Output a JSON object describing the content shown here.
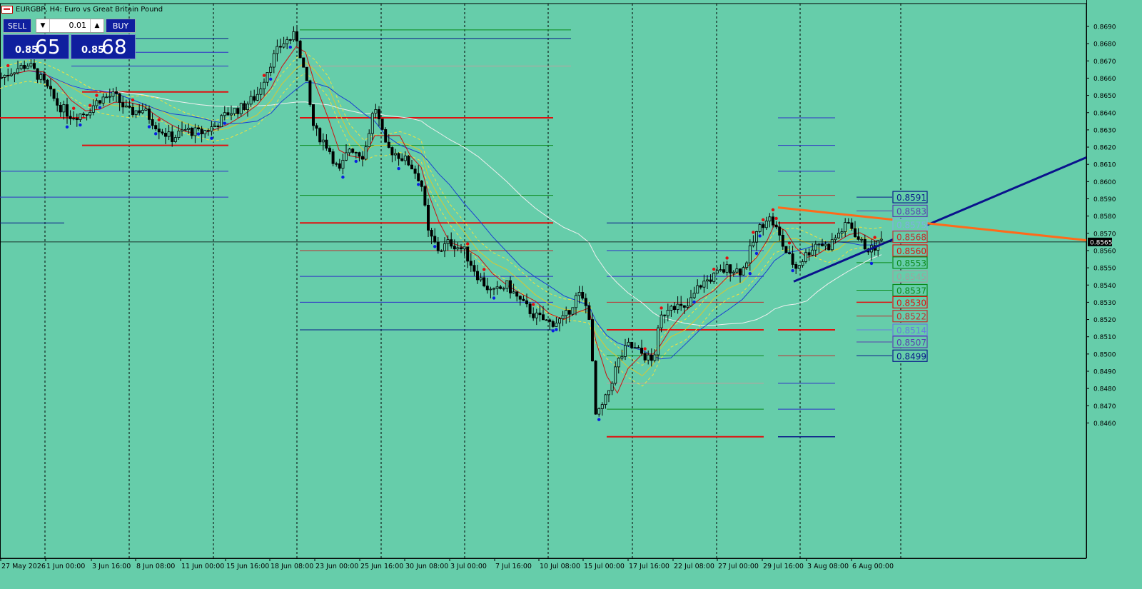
{
  "header": {
    "symbol_title": "EURGBP, H4: Euro vs Great Britain Pound"
  },
  "trade_panel": {
    "sell_label": "SELL",
    "buy_label": "BUY",
    "lot_value": "0.01",
    "sell_price_prefix": "0.85",
    "sell_price_big": "65",
    "buy_price_prefix": "0.85",
    "buy_price_big": "68"
  },
  "colors": {
    "background": "#66cdaa",
    "bull_candle": "#000000",
    "bear_candle": "#000000",
    "ma_red": "#cc1111",
    "ma_blue": "#1a3fd1",
    "ma_white": "#f0f0f0",
    "envelope_yellow": "#f0e040",
    "trendline_blue": "#0a128c",
    "trendline_orange": "#ff6a1a",
    "level_red": "#e01010",
    "level_green": "#0a8a1a",
    "level_blue": "#3030c8",
    "level_darkblue": "#0a1a8a"
  },
  "chart_data": {
    "type": "candlestick",
    "symbol": "EURGBP",
    "timeframe": "H4",
    "ylim": [
      0.8455,
      0.8695
    ],
    "current_price": "0.8565",
    "y_ticks": [
      "0.8690",
      "0.8680",
      "0.8670",
      "0.8660",
      "0.8650",
      "0.8640",
      "0.8630",
      "0.8620",
      "0.8610",
      "0.8600",
      "0.8590",
      "0.8580",
      "0.8570",
      "0.8560",
      "0.8550",
      "0.8540",
      "0.8530",
      "0.8520",
      "0.8510",
      "0.8500",
      "0.8490",
      "0.8480",
      "0.8470",
      "0.8460"
    ],
    "x_ticks": [
      "27 May 2026",
      "1 Jun 00:00",
      "3 Jun 16:00",
      "8 Jun 08:00",
      "11 Jun 00:00",
      "15 Jun 16:00",
      "18 Jun 08:00",
      "23 Jun 00:00",
      "25 Jun 16:00",
      "30 Jun 08:00",
      "3 Jul 00:00",
      "7 Jul 16:00",
      "10 Jul 08:00",
      "15 Jul 00:00",
      "17 Jul 16:00",
      "22 Jul 08:00",
      "27 Jul 00:00",
      "29 Jul 16:00",
      "3 Aug 08:00",
      "6 Aug 00:00"
    ],
    "level_labels": [
      {
        "label": "0.8591",
        "price": 0.8591,
        "color": "#0a1a8a"
      },
      {
        "label": "0.8583",
        "price": 0.8583,
        "color": "#5a40b0"
      },
      {
        "label": "0.8575",
        "price": 0.8575,
        "color": "#7fb0e0"
      },
      {
        "label": "0.8568",
        "price": 0.8568,
        "color": "#c03030"
      },
      {
        "label": "0.8560",
        "price": 0.856,
        "color": "#e01010"
      },
      {
        "label": "0.8553",
        "price": 0.8553,
        "color": "#0a8a1a"
      },
      {
        "label": "0.8545",
        "price": 0.8545,
        "color": "#a0a0a0"
      },
      {
        "label": "0.8537",
        "price": 0.8537,
        "color": "#0a8a1a"
      },
      {
        "label": "0.8530",
        "price": 0.853,
        "color": "#e01010"
      },
      {
        "label": "0.8522",
        "price": 0.8522,
        "color": "#c03030"
      },
      {
        "label": "0.8514",
        "price": 0.8514,
        "color": "#6a7ae0"
      },
      {
        "label": "0.8507",
        "price": 0.8507,
        "color": "#5a40b0"
      },
      {
        "label": "0.8499",
        "price": 0.8499,
        "color": "#0a1a8a"
      }
    ],
    "price_path": [
      [
        0,
        0.866
      ],
      [
        20,
        0.8665
      ],
      [
        40,
        0.8668
      ],
      [
        60,
        0.8658
      ],
      [
        80,
        0.8645
      ],
      [
        100,
        0.8638
      ],
      [
        120,
        0.864
      ],
      [
        140,
        0.8648
      ],
      [
        160,
        0.865
      ],
      [
        180,
        0.864
      ],
      [
        200,
        0.8642
      ],
      [
        220,
        0.8632
      ],
      [
        240,
        0.8625
      ],
      [
        260,
        0.863
      ],
      [
        280,
        0.8628
      ],
      [
        300,
        0.8632
      ],
      [
        320,
        0.864
      ],
      [
        340,
        0.8643
      ],
      [
        360,
        0.865
      ],
      [
        380,
        0.867
      ],
      [
        395,
        0.868
      ],
      [
        415,
        0.8685
      ],
      [
        428,
        0.866
      ],
      [
        440,
        0.863
      ],
      [
        460,
        0.862
      ],
      [
        475,
        0.8605
      ],
      [
        490,
        0.862
      ],
      [
        510,
        0.8615
      ],
      [
        525,
        0.8645
      ],
      [
        540,
        0.862
      ],
      [
        560,
        0.8615
      ],
      [
        575,
        0.861
      ],
      [
        590,
        0.86
      ],
      [
        600,
        0.857
      ],
      [
        615,
        0.856
      ],
      [
        630,
        0.8565
      ],
      [
        650,
        0.856
      ],
      [
        670,
        0.8545
      ],
      [
        690,
        0.8535
      ],
      [
        710,
        0.854
      ],
      [
        730,
        0.853
      ],
      [
        750,
        0.8522
      ],
      [
        770,
        0.8518
      ],
      [
        790,
        0.852
      ],
      [
        810,
        0.8535
      ],
      [
        825,
        0.8525
      ],
      [
        835,
        0.8462
      ],
      [
        850,
        0.8475
      ],
      [
        865,
        0.8495
      ],
      [
        880,
        0.8505
      ],
      [
        900,
        0.85
      ],
      [
        915,
        0.8495
      ],
      [
        925,
        0.852
      ],
      [
        940,
        0.853
      ],
      [
        960,
        0.8525
      ],
      [
        980,
        0.854
      ],
      [
        1000,
        0.8545
      ],
      [
        1020,
        0.855
      ],
      [
        1040,
        0.8548
      ],
      [
        1060,
        0.857
      ],
      [
        1075,
        0.858
      ],
      [
        1085,
        0.8575
      ],
      [
        1100,
        0.856
      ],
      [
        1115,
        0.855
      ],
      [
        1130,
        0.8558
      ],
      [
        1145,
        0.8565
      ],
      [
        1160,
        0.8562
      ],
      [
        1175,
        0.857
      ],
      [
        1190,
        0.8576
      ],
      [
        1205,
        0.8565
      ],
      [
        1220,
        0.856
      ],
      [
        1235,
        0.8566
      ]
    ]
  }
}
